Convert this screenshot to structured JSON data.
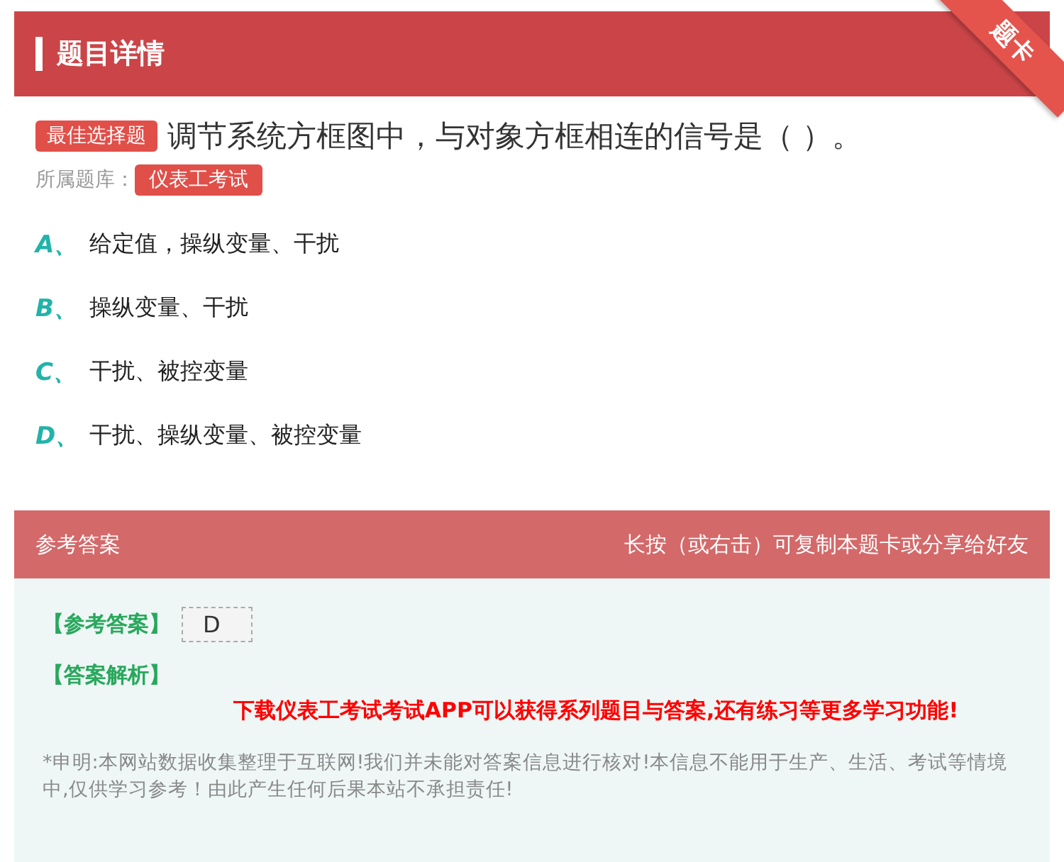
{
  "header": {
    "title": "题目详情",
    "ribbon": "题卡"
  },
  "question": {
    "type_badge": "最佳选择题",
    "text": "调节系统方框图中，与对象方框相连的信号是（ ）。",
    "bank_label": "所属题库：",
    "bank": "仪表工考试"
  },
  "options": [
    {
      "letter": "A、",
      "text": "给定值，操纵变量、干扰"
    },
    {
      "letter": "B、",
      "text": "操纵变量、干扰"
    },
    {
      "letter": "C、",
      "text": "干扰、被控变量"
    },
    {
      "letter": "D、",
      "text": "干扰、操纵变量、被控变量"
    }
  ],
  "answer_panel": {
    "title": "参考答案",
    "hint": "长按（或右击）可复制本题卡或分享给好友",
    "answer_label": "【参考答案】",
    "answer": "D",
    "analysis_label": "【答案解析】",
    "promo": "下载仪表工考试考试APP可以获得系列题目与答案,还有练习等更多学习功能!",
    "disclaimer": "*申明:本网站数据收集整理于互联网!我们并未能对答案信息进行核对!本信息不能用于生产、生活、考试等情境中,仅供学习参考！由此产生任何后果本站不承担责任!"
  }
}
